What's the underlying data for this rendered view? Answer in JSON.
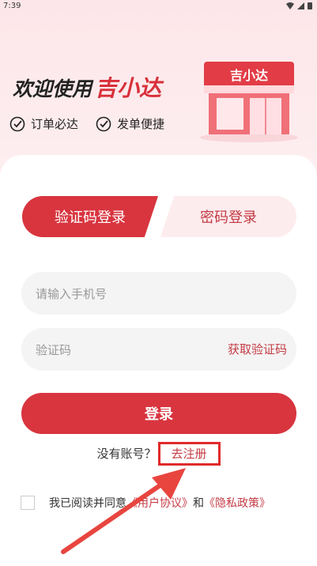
{
  "status_bar": {
    "time": "7:39"
  },
  "hero": {
    "welcome": "欢迎使用",
    "brand": "吉小达",
    "shop_sign": "吉小达"
  },
  "features": [
    {
      "label": "订单必达"
    },
    {
      "label": "发单便捷"
    }
  ],
  "tabs": [
    {
      "label": "验证码登录",
      "active": true
    },
    {
      "label": "密码登录",
      "active": false
    }
  ],
  "form": {
    "phone_placeholder": "请输入手机号",
    "code_placeholder": "验证码",
    "get_code_label": "获取验证码",
    "login_label": "登录"
  },
  "register": {
    "prompt": "没有账号？",
    "link": "去注册"
  },
  "agreement": {
    "prefix": "我已阅读并同意",
    "user_agreement": "《用户协议》",
    "and": "和",
    "privacy_policy": "《隐私政策》"
  },
  "colors": {
    "accent": "#d8353f",
    "accent_light": "#fdecee",
    "link": "#c43c45",
    "annotation": "#e02a2a"
  }
}
